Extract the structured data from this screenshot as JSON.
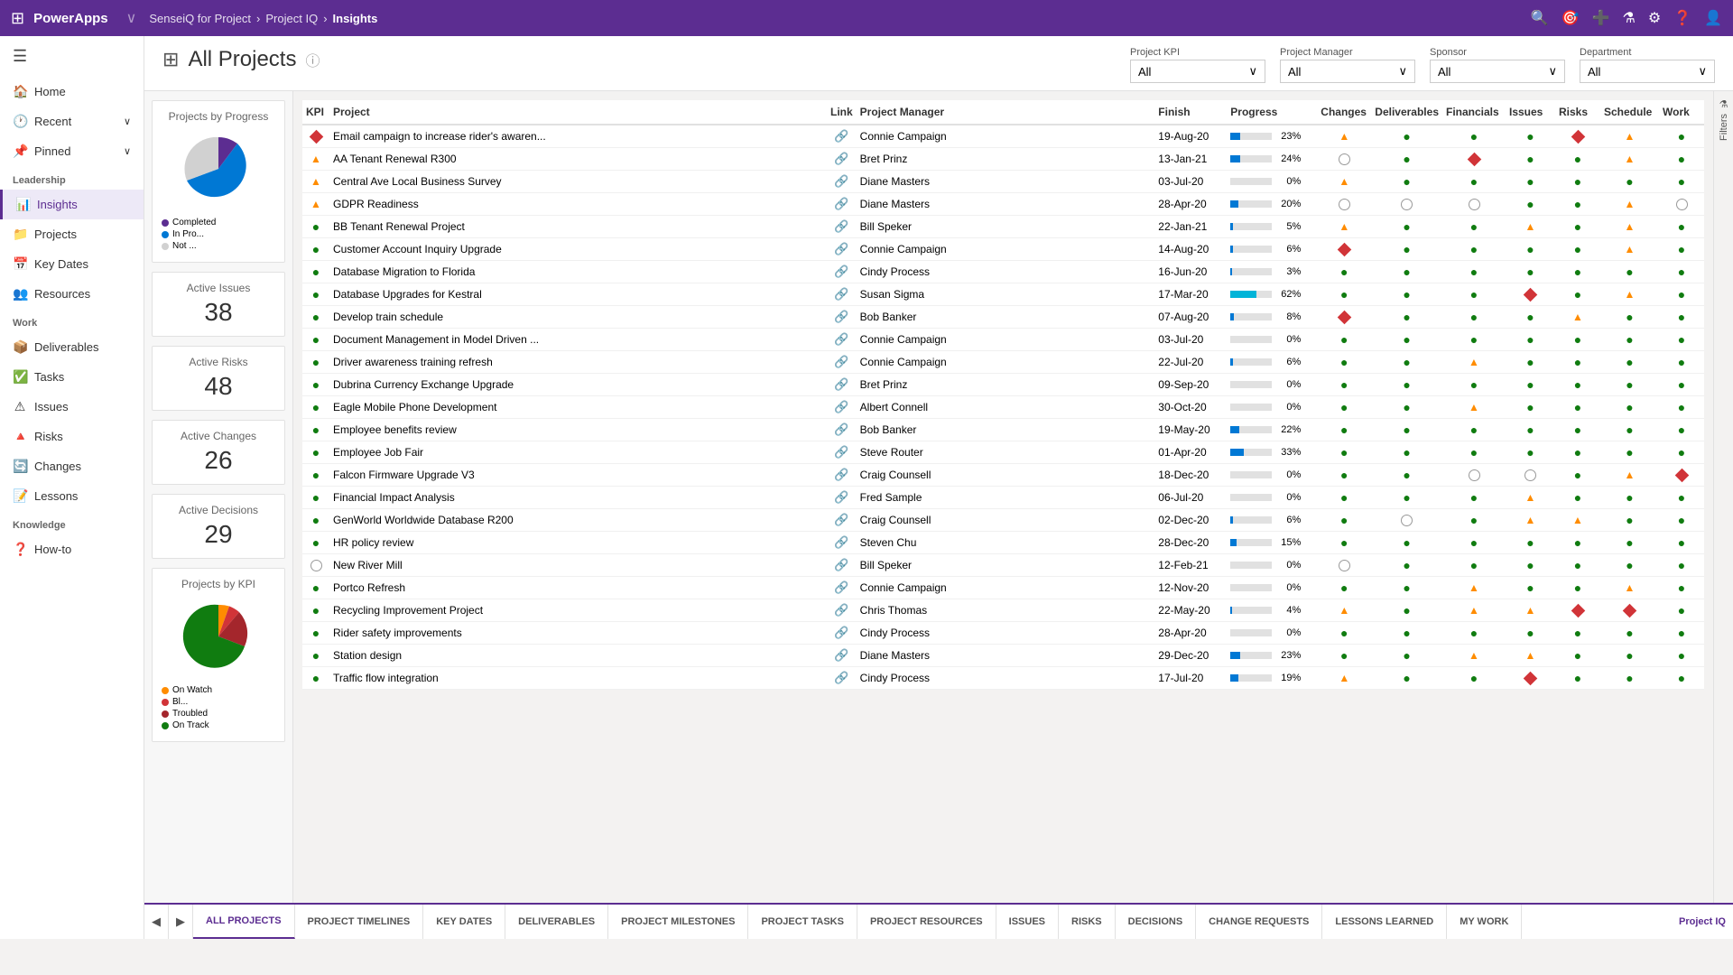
{
  "topbar": {
    "app_name": "PowerApps",
    "product": "SenseiQ for Project",
    "breadcrumb1": "Project IQ",
    "breadcrumb_sep": ">",
    "breadcrumb2": "Insights"
  },
  "sidebar": {
    "sections": [
      {
        "label": "Leadership",
        "items": [
          {
            "id": "insights",
            "icon": "📊",
            "label": "Insights",
            "active": true
          },
          {
            "id": "projects",
            "icon": "📁",
            "label": "Projects",
            "active": false
          },
          {
            "id": "key-dates",
            "icon": "📅",
            "label": "Key Dates",
            "active": false
          },
          {
            "id": "resources",
            "icon": "👥",
            "label": "Resources",
            "active": false
          }
        ]
      },
      {
        "label": "Work",
        "items": [
          {
            "id": "deliverables",
            "icon": "📦",
            "label": "Deliverables",
            "active": false
          },
          {
            "id": "tasks",
            "icon": "✅",
            "label": "Tasks",
            "active": false
          },
          {
            "id": "issues",
            "icon": "⚠",
            "label": "Issues",
            "active": false
          },
          {
            "id": "risks",
            "icon": "🔺",
            "label": "Risks",
            "active": false
          },
          {
            "id": "changes",
            "icon": "🔄",
            "label": "Changes",
            "active": false
          },
          {
            "id": "lessons",
            "icon": "📝",
            "label": "Lessons",
            "active": false
          }
        ]
      },
      {
        "label": "Knowledge",
        "items": [
          {
            "id": "how-to",
            "icon": "❓",
            "label": "How-to",
            "active": false
          }
        ]
      }
    ],
    "home": "Home",
    "recent": "Recent",
    "pinned": "Pinned"
  },
  "page": {
    "title": "All Projects",
    "info_icon": "ⓘ"
  },
  "filters": {
    "project_kpi": {
      "label": "Project KPI",
      "value": "All"
    },
    "project_manager": {
      "label": "Project Manager",
      "value": "All"
    },
    "sponsor": {
      "label": "Sponsor",
      "value": "All"
    },
    "department": {
      "label": "Department",
      "value": "All"
    }
  },
  "stats": {
    "active_issues": {
      "title": "Active Issues",
      "value": "38"
    },
    "active_risks": {
      "title": "Active Risks",
      "value": "48"
    },
    "active_changes": {
      "title": "Active Changes",
      "value": "26"
    },
    "active_decisions": {
      "title": "Active Decisions",
      "value": "29"
    }
  },
  "pie_by_progress": {
    "title": "Projects by Progress",
    "legend": [
      {
        "label": "Completed",
        "color": "#5c2d91",
        "value": 15
      },
      {
        "label": "In Pro...",
        "color": "#0078d4",
        "value": 55
      },
      {
        "label": "Not ...",
        "color": "#e1e1e1",
        "value": 30
      }
    ]
  },
  "pie_by_kpi": {
    "title": "Projects by KPI",
    "legend": [
      {
        "label": "On Watch",
        "color": "#ff8c00",
        "value": 10
      },
      {
        "label": "Bl...",
        "color": "#d13438",
        "value": 8
      },
      {
        "label": "Troubled",
        "color": "#a4262c",
        "value": 20
      },
      {
        "label": "On Track",
        "color": "#107c10",
        "value": 62
      }
    ]
  },
  "table": {
    "columns": [
      "KPI",
      "Project",
      "Link",
      "Project Manager",
      "Finish",
      "Progress",
      "Changes",
      "Deliverables",
      "Financials",
      "Issues",
      "Risks",
      "Schedule",
      "Work"
    ],
    "rows": [
      {
        "kpi": "red",
        "project": "Email campaign to increase rider's awaren...",
        "link": true,
        "manager": "Connie Campaign",
        "finish": "19-Aug-20",
        "progress": 23,
        "changes": "orange",
        "deliverables": "green",
        "financials": "green",
        "issues": "green",
        "risks": "red",
        "schedule": "orange",
        "work": "green"
      },
      {
        "kpi": "orange",
        "project": "AA Tenant Renewal R300",
        "link": true,
        "manager": "Bret Prinz",
        "finish": "13-Jan-21",
        "progress": 24,
        "changes": "empty",
        "deliverables": "green",
        "financials": "red",
        "issues": "green",
        "risks": "green",
        "schedule": "orange",
        "work": "green"
      },
      {
        "kpi": "orange",
        "project": "Central Ave Local Business Survey",
        "link": true,
        "manager": "Diane Masters",
        "finish": "03-Jul-20",
        "progress": 0,
        "changes": "orange",
        "deliverables": "green",
        "financials": "green",
        "issues": "green",
        "risks": "green",
        "schedule": "green",
        "work": "green"
      },
      {
        "kpi": "orange",
        "project": "GDPR Readiness",
        "link": true,
        "manager": "Diane Masters",
        "finish": "28-Apr-20",
        "progress": 20,
        "changes": "empty",
        "deliverables": "empty",
        "financials": "empty",
        "issues": "green",
        "risks": "green",
        "schedule": "orange",
        "work": "empty"
      },
      {
        "kpi": "green",
        "project": "BB Tenant Renewal Project",
        "link": true,
        "manager": "Bill Speker",
        "finish": "22-Jan-21",
        "progress": 5,
        "changes": "orange",
        "deliverables": "green",
        "financials": "green",
        "issues": "orange",
        "risks": "green",
        "schedule": "orange",
        "work": "green"
      },
      {
        "kpi": "green",
        "project": "Customer Account Inquiry Upgrade",
        "link": true,
        "manager": "Connie Campaign",
        "finish": "14-Aug-20",
        "progress": 6,
        "changes": "red",
        "deliverables": "green",
        "financials": "green",
        "issues": "green",
        "risks": "green",
        "schedule": "orange",
        "work": "green"
      },
      {
        "kpi": "green",
        "project": "Database Migration to Florida",
        "link": true,
        "manager": "Cindy Process",
        "finish": "16-Jun-20",
        "progress": 3,
        "changes": "green",
        "deliverables": "green",
        "financials": "green",
        "issues": "green",
        "risks": "green",
        "schedule": "green",
        "work": "green"
      },
      {
        "kpi": "green",
        "project": "Database Upgrades for Kestral",
        "link": true,
        "manager": "Susan Sigma",
        "finish": "17-Mar-20",
        "progress": 62,
        "changes": "green",
        "deliverables": "green",
        "financials": "green",
        "issues": "red",
        "risks": "green",
        "schedule": "orange",
        "work": "green"
      },
      {
        "kpi": "green",
        "project": "Develop train schedule",
        "link": true,
        "manager": "Bob Banker",
        "finish": "07-Aug-20",
        "progress": 8,
        "changes": "red",
        "deliverables": "green",
        "financials": "green",
        "issues": "green",
        "risks": "orange",
        "schedule": "green",
        "work": "green"
      },
      {
        "kpi": "green",
        "project": "Document Management in Model Driven ...",
        "link": true,
        "manager": "Connie Campaign",
        "finish": "03-Jul-20",
        "progress": 0,
        "changes": "green",
        "deliverables": "green",
        "financials": "green",
        "issues": "green",
        "risks": "green",
        "schedule": "green",
        "work": "green"
      },
      {
        "kpi": "green",
        "project": "Driver awareness training refresh",
        "link": true,
        "manager": "Connie Campaign",
        "finish": "22-Jul-20",
        "progress": 6,
        "changes": "green",
        "deliverables": "green",
        "financials": "orange",
        "issues": "green",
        "risks": "green",
        "schedule": "green",
        "work": "green"
      },
      {
        "kpi": "green",
        "project": "Dubrina Currency Exchange Upgrade",
        "link": true,
        "manager": "Bret Prinz",
        "finish": "09-Sep-20",
        "progress": 0,
        "changes": "green",
        "deliverables": "green",
        "financials": "green",
        "issues": "green",
        "risks": "green",
        "schedule": "green",
        "work": "green"
      },
      {
        "kpi": "green",
        "project": "Eagle Mobile Phone Development",
        "link": true,
        "manager": "Albert Connell",
        "finish": "30-Oct-20",
        "progress": 0,
        "changes": "green",
        "deliverables": "green",
        "financials": "orange",
        "issues": "green",
        "risks": "green",
        "schedule": "green",
        "work": "green"
      },
      {
        "kpi": "green",
        "project": "Employee benefits review",
        "link": true,
        "manager": "Bob Banker",
        "finish": "19-May-20",
        "progress": 22,
        "changes": "green",
        "deliverables": "green",
        "financials": "green",
        "issues": "green",
        "risks": "green",
        "schedule": "green",
        "work": "green"
      },
      {
        "kpi": "green",
        "project": "Employee Job Fair",
        "link": true,
        "manager": "Steve Router",
        "finish": "01-Apr-20",
        "progress": 33,
        "changes": "green",
        "deliverables": "green",
        "financials": "green",
        "issues": "green",
        "risks": "green",
        "schedule": "green",
        "work": "green"
      },
      {
        "kpi": "green",
        "project": "Falcon Firmware Upgrade V3",
        "link": true,
        "manager": "Craig Counsell",
        "finish": "18-Dec-20",
        "progress": 0,
        "changes": "green",
        "deliverables": "green",
        "financials": "empty",
        "issues": "empty",
        "risks": "green",
        "schedule": "orange",
        "work": "red"
      },
      {
        "kpi": "green",
        "project": "Financial Impact Analysis",
        "link": true,
        "manager": "Fred Sample",
        "finish": "06-Jul-20",
        "progress": 0,
        "changes": "green",
        "deliverables": "green",
        "financials": "green",
        "issues": "orange",
        "risks": "green",
        "schedule": "green",
        "work": "green"
      },
      {
        "kpi": "green",
        "project": "GenWorld Worldwide Database R200",
        "link": true,
        "manager": "Craig Counsell",
        "finish": "02-Dec-20",
        "progress": 6,
        "changes": "green",
        "deliverables": "empty",
        "financials": "green",
        "issues": "orange",
        "risks": "orange",
        "schedule": "green",
        "work": "green"
      },
      {
        "kpi": "green",
        "project": "HR policy review",
        "link": true,
        "manager": "Steven Chu",
        "finish": "28-Dec-20",
        "progress": 15,
        "changes": "green",
        "deliverables": "green",
        "financials": "green",
        "issues": "green",
        "risks": "green",
        "schedule": "green",
        "work": "green"
      },
      {
        "kpi": "empty",
        "project": "New River Mill",
        "link": true,
        "manager": "Bill Speker",
        "finish": "12-Feb-21",
        "progress": 0,
        "changes": "empty",
        "deliverables": "green",
        "financials": "green",
        "issues": "green",
        "risks": "green",
        "schedule": "green",
        "work": "green"
      },
      {
        "kpi": "green",
        "project": "Portco Refresh",
        "link": true,
        "manager": "Connie Campaign",
        "finish": "12-Nov-20",
        "progress": 0,
        "changes": "green",
        "deliverables": "green",
        "financials": "orange",
        "issues": "green",
        "risks": "green",
        "schedule": "orange",
        "work": "green"
      },
      {
        "kpi": "green",
        "project": "Recycling Improvement Project",
        "link": true,
        "manager": "Chris Thomas",
        "finish": "22-May-20",
        "progress": 4,
        "changes": "orange",
        "deliverables": "green",
        "financials": "orange",
        "issues": "orange",
        "risks": "red",
        "schedule": "red",
        "work": "green"
      },
      {
        "kpi": "green",
        "project": "Rider safety improvements",
        "link": true,
        "manager": "Cindy Process",
        "finish": "28-Apr-20",
        "progress": 0,
        "changes": "green",
        "deliverables": "green",
        "financials": "green",
        "issues": "green",
        "risks": "green",
        "schedule": "green",
        "work": "green"
      },
      {
        "kpi": "green",
        "project": "Station design",
        "link": true,
        "manager": "Diane Masters",
        "finish": "29-Dec-20",
        "progress": 23,
        "changes": "green",
        "deliverables": "green",
        "financials": "orange",
        "issues": "orange",
        "risks": "green",
        "schedule": "green",
        "work": "green"
      },
      {
        "kpi": "green",
        "project": "Traffic flow integration",
        "link": true,
        "manager": "Cindy Process",
        "finish": "17-Jul-20",
        "progress": 19,
        "changes": "orange",
        "deliverables": "green",
        "financials": "green",
        "issues": "red",
        "risks": "green",
        "schedule": "green",
        "work": "green"
      }
    ]
  },
  "bottom_tabs": [
    {
      "id": "all-projects",
      "label": "ALL PROJECTS",
      "active": true
    },
    {
      "id": "project-timelines",
      "label": "PROJECT TIMELINES",
      "active": false
    },
    {
      "id": "key-dates",
      "label": "KEY DATES",
      "active": false
    },
    {
      "id": "deliverables",
      "label": "DELIVERABLES",
      "active": false
    },
    {
      "id": "project-milestones",
      "label": "PROJECT MILESTONES",
      "active": false
    },
    {
      "id": "project-tasks",
      "label": "PROJECT TASKS",
      "active": false
    },
    {
      "id": "project-resources",
      "label": "PROJECT RESOURCES",
      "active": false
    },
    {
      "id": "issues",
      "label": "ISSUES",
      "active": false
    },
    {
      "id": "risks",
      "label": "RISKS",
      "active": false
    },
    {
      "id": "decisions",
      "label": "DECISIONS",
      "active": false
    },
    {
      "id": "change-requests",
      "label": "CHANGE REQUESTS",
      "active": false
    },
    {
      "id": "lessons-learned",
      "label": "LESSONS LEARNED",
      "active": false
    },
    {
      "id": "my-work",
      "label": "MY WORK",
      "active": false
    }
  ]
}
